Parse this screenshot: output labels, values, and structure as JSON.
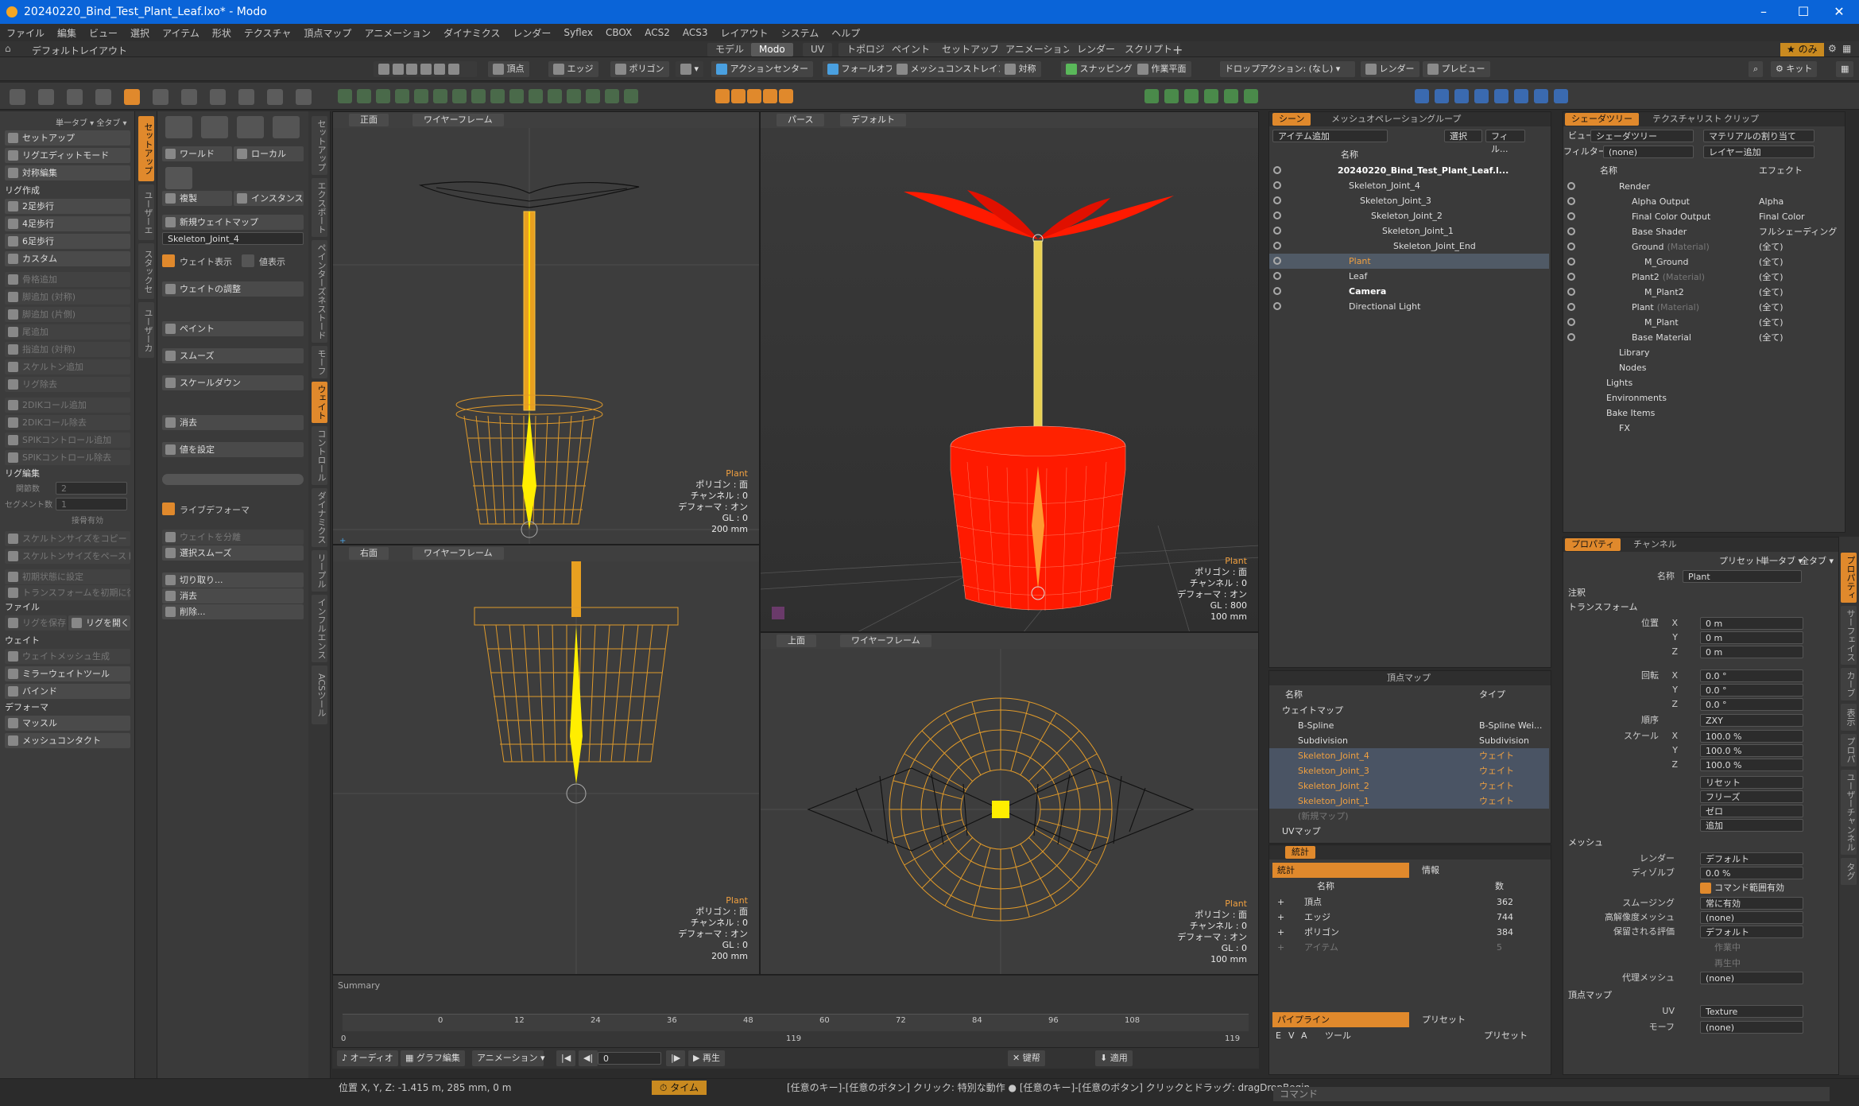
{
  "title": "20240220_Bind_Test_Plant_Leaf.lxo* - Modo",
  "menu": [
    "ファイル",
    "編集",
    "ビュー",
    "選択",
    "アイテム",
    "形状",
    "テクスチャ",
    "頂点マップ",
    "アニメーション",
    "ダイナミクス",
    "レンダー",
    "Syflex",
    "CBOX",
    "ACS2",
    "ACS3",
    "レイアウト",
    "システム",
    "ヘルプ"
  ],
  "layout_label": "デフォルトレイアウト",
  "layout_tabs": [
    "モデル",
    "Modo",
    "UV",
    "トポロジ",
    "ペイント",
    "セットアップ",
    "アニメーション",
    "レンダー",
    "スクリプト"
  ],
  "layout_right": "のみ",
  "toolbar": {
    "vertex": "頂点",
    "edge": "エッジ",
    "polygon": "ポリゴン",
    "action_center": "アクションセンター",
    "falloff": "フォールオフ",
    "mesh_constraint": "メッシュコンストレイント",
    "symmetry": "対称",
    "snapping": "スナッピング",
    "work_plane": "作業平面",
    "drop_action": "ドロップアクション: (なし)",
    "render": "レンダー",
    "preview": "プレビュー",
    "kit": "キット"
  },
  "left1": {
    "header": "単一タブ ▾  全タブ ▾",
    "top": [
      "セットアップ",
      "リグエディットモード",
      "対称編集"
    ],
    "sec_rig": "リグ作成",
    "rig": [
      "2足歩行",
      "4足歩行",
      "6足歩行",
      "カスタム"
    ],
    "dim1": [
      "骨格追加",
      "脚追加 (対称)",
      "脚追加 (片側)",
      "尾追加",
      "指追加 (対称)",
      "スケルトン追加",
      "リグ除去"
    ],
    "dim2": [
      "2DIKコール追加",
      "2DIKコール除去",
      "SPIKコントロール追加",
      "SPIKコントロール除去"
    ],
    "sec_edit": "リグ編集",
    "joint_count_label": "関節数",
    "joint_count": "2",
    "seg_label": "セグメント数",
    "seg": "1",
    "bone_label": "接骨有効",
    "dim3": [
      "スケルトンサイズをコピー",
      "スケルトンサイズをペースト"
    ],
    "dim4": [
      "初期状態に設定",
      "トランスフォームを初期に復帰"
    ],
    "sec_file": "ファイル",
    "save_rig": "リグを保存",
    "open_rig": "リグを開く",
    "sec_weight": "ウェイト",
    "weight": [
      "ウェイトメッシュ生成",
      "ミラーウェイトツール",
      "バインド"
    ],
    "sec_deform": "デフォーマ",
    "deform": [
      "マッスル",
      "メッシュコンタクト"
    ]
  },
  "vtabs1": [
    "セットアップ",
    "ユーザーエ",
    "スタックセ",
    "ユーザーカ"
  ],
  "left2": {
    "world": "ワールド",
    "local": "ローカル",
    "duplicate": "複製",
    "instance": "インスタンス",
    "new_weight_map": "新規ウェイトマップ",
    "joint": "Skeleton_Joint_4",
    "show_weight": "ウェイト表示",
    "show_value": "値表示",
    "adjust": "ウェイトの調整",
    "tools": [
      "ペイント",
      "スムーズ",
      "スケールダウン"
    ],
    "erase": "消去",
    "set_value": "値を設定",
    "live_deformer": "ライブデフォーマ",
    "sel_weight": "ウェイトを分離",
    "sel_smooth": "選択スムーズ",
    "cut": "切り取り...",
    "del": "消去",
    "remove": "削除..."
  },
  "vtabs2": [
    "セットアップ",
    "エクスポート",
    "ペインターズネストード",
    "モーフ",
    "ウェイト",
    "コントロール",
    "ダイナミクス",
    "リープル",
    "インフルエンス",
    "ACSツール"
  ],
  "viewports": {
    "front": {
      "label": "正面",
      "shade": "ワイヤーフレーム",
      "name": "Plant",
      "poly": "ポリゴン : 面",
      "chan": "チャンネル : 0",
      "deform": "デフォーマ : オン",
      "gl": "GL : 0",
      "scale": "200 mm"
    },
    "persp": {
      "label": "パース",
      "shade": "デフォルト",
      "name": "Plant",
      "poly": "ポリゴン : 面",
      "chan": "チャンネル : 0",
      "deform": "デフォーマ : オン",
      "gl": "GL : 800",
      "scale": "100 mm"
    },
    "right": {
      "label": "右面",
      "shade": "ワイヤーフレーム",
      "name": "Plant",
      "poly": "ポリゴン : 面",
      "chan": "チャンネル : 0",
      "deform": "デフォーマ : オン",
      "gl": "GL : 0",
      "scale": "200 mm"
    },
    "top": {
      "label": "上面",
      "shade": "ワイヤーフレーム",
      "name": "Plant",
      "poly": "ポリゴン : 面",
      "chan": "チャンネル : 0",
      "deform": "デフォーマ : オン",
      "gl": "GL : 0",
      "scale": "100 mm"
    }
  },
  "timeline": {
    "summary": "Summary",
    "ticks": [
      "0",
      "12",
      "24",
      "36",
      "48",
      "60",
      "72",
      "84",
      "96",
      "108"
    ],
    "start": "0",
    "mid": "119",
    "end": "119"
  },
  "bottom": {
    "audio": "オーディオ",
    "graph": "グラフ編集",
    "anim": "アニメーション",
    "frame": "0",
    "play": "再生",
    "key": "键帮",
    "apply": "適用"
  },
  "status": {
    "pos": "位置 X, Y, Z:  -1.415 m, 285 mm, 0 m",
    "time": "タイム",
    "hint": "[任意のキー]-[任意のボタン] クリック: 特別な動作 ●  [任意のキー]-[任意のボタン] クリックとドラッグ: dragDropBegin",
    "cmd": "コマンド"
  },
  "scene": {
    "tabs": [
      "シーン",
      "メッシュオペレーション",
      "グループ"
    ],
    "add_item": "アイテム追加",
    "select": "選択",
    "filter": "フィル...",
    "col_name": "名称",
    "items": [
      {
        "name": "20240220_Bind_Test_Plant_Leaf.l...",
        "indent": 0,
        "bold": true
      },
      {
        "name": "Skeleton_Joint_4",
        "indent": 1
      },
      {
        "name": "Skeleton_Joint_3",
        "indent": 2
      },
      {
        "name": "Skeleton_Joint_2",
        "indent": 3
      },
      {
        "name": "Skeleton_Joint_1",
        "indent": 4
      },
      {
        "name": "Skeleton_Joint_End",
        "indent": 5
      },
      {
        "name": "Plant",
        "indent": 1,
        "sel": true
      },
      {
        "name": "Leaf",
        "indent": 1
      },
      {
        "name": "Camera",
        "indent": 1,
        "bold": true
      },
      {
        "name": "Directional Light",
        "indent": 1
      }
    ]
  },
  "vmap": {
    "title": "頂点マップ",
    "col_name": "名称",
    "col_type": "タイプ",
    "rows": [
      {
        "name": "ウェイトマップ",
        "type": "",
        "indent": 0
      },
      {
        "name": "B-Spline",
        "type": "B-Spline Wei...",
        "indent": 1
      },
      {
        "name": "Subdivision",
        "type": "Subdivision",
        "indent": 1
      },
      {
        "name": "Skeleton_Joint_4",
        "type": "ウェイト",
        "indent": 1,
        "hl": true
      },
      {
        "name": "Skeleton_Joint_3",
        "type": "ウェイト",
        "indent": 1,
        "hl": true
      },
      {
        "name": "Skeleton_Joint_2",
        "type": "ウェイト",
        "indent": 1,
        "hl": true
      },
      {
        "name": "Skeleton_Joint_1",
        "type": "ウェイト",
        "indent": 1,
        "hl": true
      },
      {
        "name": "(新規マップ)",
        "type": "",
        "indent": 1,
        "dim": true
      },
      {
        "name": "UVマップ",
        "type": "",
        "indent": 0
      }
    ]
  },
  "stats": {
    "tab": "統計",
    "info_tab": "統計",
    "info": "情報",
    "col_name": "名称",
    "col_num": "数",
    "rows": [
      {
        "name": "頂点",
        "n": "362"
      },
      {
        "name": "エッジ",
        "n": "744"
      },
      {
        "name": "ポリゴン",
        "n": "384"
      },
      {
        "name": "アイテム",
        "n": "5"
      }
    ],
    "pipeline": "パイプライン",
    "preset": "プリセット",
    "cols": [
      "E",
      "V",
      "A",
      "ツール",
      "プリセット"
    ]
  },
  "shader": {
    "tabs": [
      "シェーダツリー",
      "テクスチャリスト",
      "クリップ"
    ],
    "view_label": "ビュー",
    "view": "シェーダツリー",
    "assign": "マテリアルの割り当て",
    "filter_label": "フィルター",
    "filter": "(none)",
    "layer_add": "レイヤー追加",
    "col_name": "名称",
    "col_effect": "エフェクト",
    "rows": [
      {
        "name": "Render",
        "effect": "",
        "indent": 0
      },
      {
        "name": "Alpha Output",
        "effect": "Alpha",
        "indent": 1
      },
      {
        "name": "Final Color Output",
        "effect": "Final Color",
        "indent": 1
      },
      {
        "name": "Base Shader",
        "effect": "フルシェーディング",
        "indent": 1
      },
      {
        "name": "Ground",
        "sub": "(Material)",
        "effect": "(全て)",
        "indent": 1
      },
      {
        "name": "M_Ground",
        "effect": "(全て)",
        "indent": 2
      },
      {
        "name": "Plant2",
        "sub": "(Material)",
        "effect": "(全て)",
        "indent": 1
      },
      {
        "name": "M_Plant2",
        "effect": "(全て)",
        "indent": 2
      },
      {
        "name": "Plant",
        "sub": "(Material)",
        "effect": "(全て)",
        "indent": 1
      },
      {
        "name": "M_Plant",
        "effect": "(全て)",
        "indent": 2
      },
      {
        "name": "Base Material",
        "effect": "(全て)",
        "indent": 1
      },
      {
        "name": "Library",
        "effect": "",
        "indent": 0
      },
      {
        "name": "Nodes",
        "effect": "",
        "indent": 0
      },
      {
        "name": "Lights",
        "effect": "",
        "indent": -1
      },
      {
        "name": "Environments",
        "effect": "",
        "indent": -1
      },
      {
        "name": "Bake Items",
        "effect": "",
        "indent": -1
      },
      {
        "name": "FX",
        "effect": "",
        "indent": 0
      }
    ]
  },
  "props": {
    "tabs": [
      "プロパティ",
      "チャンネル"
    ],
    "preset": "プリセット",
    "single_tab": "単一タブ ▾",
    "all_tab": "全タブ ▾",
    "name_label": "名称",
    "name": "Plant",
    "sec_note": "注釈",
    "sec_transform": "トランスフォーム",
    "pos_label": "位置",
    "rot_label": "回転",
    "scale_label": "スケール",
    "order_label": "順序",
    "x": "X",
    "y": "Y",
    "z": "Z",
    "pos": [
      "0 m",
      "0 m",
      "0 m"
    ],
    "rot": [
      "0.0 °",
      "0.0 °",
      "0.0 °"
    ],
    "order": "ZXY",
    "scale": [
      "100.0 %",
      "100.0 %",
      "100.0 %"
    ],
    "btns": [
      "リセット",
      "フリーズ",
      "ゼロ",
      "追加"
    ],
    "sec_mesh": "メッシュ",
    "render_label": "レンダー",
    "render": "デフォルト",
    "dissolve_label": "ディゾルブ",
    "dissolve": "0.0 %",
    "cmd_range": "コマンド範囲有効",
    "smooth_label": "スムージング",
    "smooth": "常に有効",
    "hires_label": "高解像度メッシュ",
    "hires": "(none)",
    "saved_label": "保留される評価",
    "saved": "デフォルト",
    "work": "作業中",
    "playback": "再生中",
    "proxy_label": "代理メッシュ",
    "proxy": "(none)",
    "sec_vmap": "頂点マップ",
    "uv_label": "UV",
    "uv": "Texture",
    "morph_label": "モーフ",
    "morph": "(none)"
  },
  "right_vtabs": [
    "プロパティ",
    "サーフェイス",
    "カーブ",
    "表示",
    "プロパ",
    "ユーザーチャンネル",
    "タグ"
  ],
  "colors": {
    "accent": "#e0892c",
    "title": "#0a64d8",
    "wire": "#e09a2a",
    "red": "#ff1a00",
    "bone": "#ffee00"
  }
}
